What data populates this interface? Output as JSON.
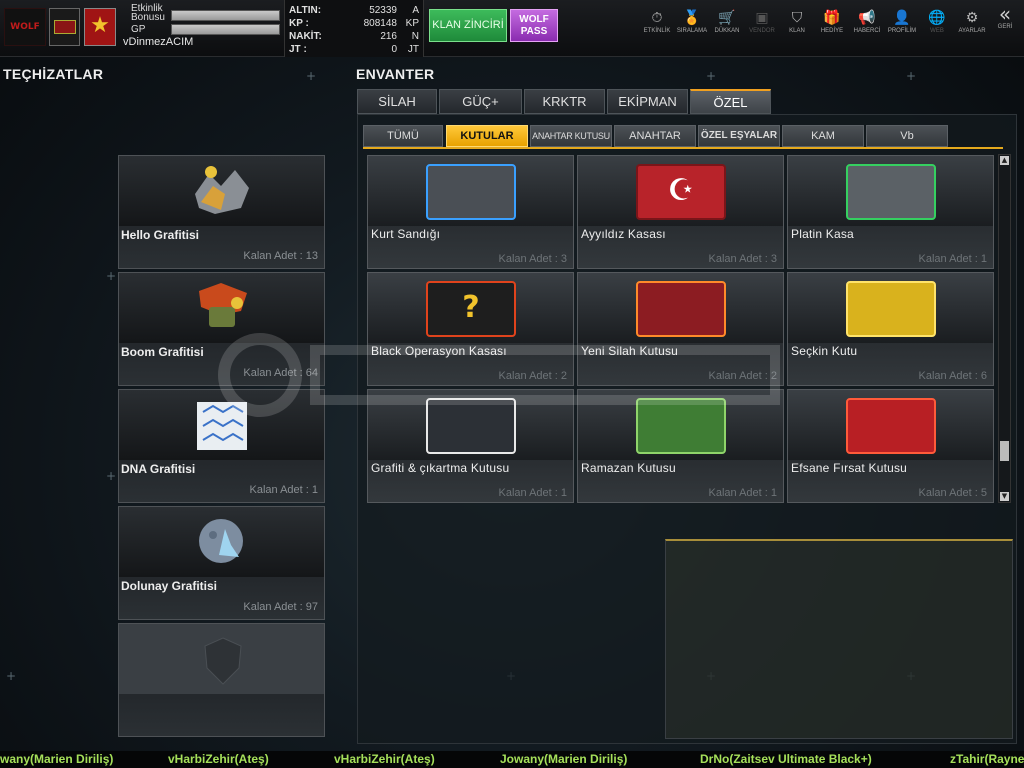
{
  "topbar": {
    "bonus_label_1": "Etkinlik",
    "bonus_label_2": "Bonusu",
    "gp_label": "GP",
    "username": "vDinmezACIM",
    "logo_text": "WOLF",
    "currency": [
      {
        "key": "ALTIN:",
        "value": "52339",
        "unit": "A"
      },
      {
        "key": "KP   :",
        "value": "808148",
        "unit": "KP"
      },
      {
        "key": "NAKİT:",
        "value": "216",
        "unit": "N"
      },
      {
        "key": "JT   :",
        "value": "0",
        "unit": "JT"
      }
    ],
    "klan_button": "KLAN ZİNCİRİ",
    "wolf_pass_1": "WOLF",
    "wolf_pass_2": "PASS",
    "nav": [
      {
        "icon": "stopwatch-icon",
        "glyph": "⏱",
        "label": "ETKİNLİK"
      },
      {
        "icon": "medal-icon",
        "glyph": "🏅",
        "label": "SIRALAMA"
      },
      {
        "icon": "cart-icon",
        "glyph": "🛒",
        "label": "DÜKKAN"
      },
      {
        "icon": "vendor-icon",
        "glyph": "▣",
        "label": "VENDOR"
      },
      {
        "icon": "shield-icon",
        "glyph": "⛉",
        "label": "KLAN"
      },
      {
        "icon": "gift-icon",
        "glyph": "🎁",
        "label": "HEDİYE"
      },
      {
        "icon": "megaphone-icon",
        "glyph": "📢",
        "label": "HABERCİ"
      },
      {
        "icon": "profile-icon",
        "glyph": "👤",
        "label": "PROFİLİM"
      },
      {
        "icon": "globe-icon",
        "glyph": "🌐",
        "label": "WEB"
      },
      {
        "icon": "gear-icon",
        "glyph": "⚙",
        "label": "AYARLAR"
      },
      {
        "icon": "back-icon",
        "glyph": "«",
        "label": "GERİ"
      }
    ]
  },
  "equipment": {
    "title": "TEÇHİZATLAR",
    "items": [
      {
        "name": "Hello Grafitisi",
        "count": "Kalan Adet : 13",
        "art": "#d8a13a"
      },
      {
        "name": "Boom Grafitisi",
        "count": "Kalan Adet : 64",
        "art": "#c94a1c"
      },
      {
        "name": "DNA Grafitisi",
        "count": "Kalan Adet : 1",
        "art": "#3a72c8"
      },
      {
        "name": "Dolunay Grafitisi",
        "count": "Kalan Adet : 97",
        "art": "#7d8da0"
      }
    ]
  },
  "inventory": {
    "title": "ENVANTER",
    "main_tabs": [
      "SİLAH",
      "GÜÇ+",
      "KRKTR",
      "EKİPMAN",
      "ÖZEL"
    ],
    "sub_tabs": [
      "TÜMÜ",
      "KUTULAR",
      "ANAHTAR KUTUSU",
      "ANAHTAR",
      "ÖZEL EŞYALAR",
      "KAM",
      "Vb"
    ],
    "items": [
      {
        "name": "Kurt Sandığı",
        "count": "Kalan Adet : 3",
        "color": "#4a4f55",
        "accent": "#3aa0ff"
      },
      {
        "name": "Ayyıldız Kasası",
        "count": "Kalan Adet : 3",
        "color": "#b8232a",
        "accent": "#ffffff"
      },
      {
        "name": "Platin Kasa",
        "count": "Kalan Adet : 1",
        "color": "#5b6166",
        "accent": "#35d060"
      },
      {
        "name": "Black Operasyon Kasası",
        "count": "Kalan Adet : 2",
        "color": "#1e1e1e",
        "accent": "#e0431c"
      },
      {
        "name": "Yeni Silah Kutusu",
        "count": "Kalan Adet : 2",
        "color": "#8c1c22",
        "accent": "#ff8a2a"
      },
      {
        "name": "Seçkin Kutu",
        "count": "Kalan Adet : 6",
        "color": "#d9b21d",
        "accent": "#ffe36a"
      },
      {
        "name": "Grafiti & çıkartma Kutusu",
        "count": "Kalan Adet : 1",
        "color": "#2c3036",
        "accent": "#e8e8e8"
      },
      {
        "name": "Ramazan Kutusu",
        "count": "Kalan Adet : 1",
        "color": "#3f7d34",
        "accent": "#8fd46a"
      },
      {
        "name": "Efsane Fırsat Kutusu",
        "count": "Kalan Adet : 5",
        "color": "#b81f24",
        "accent": "#ff5a3a"
      }
    ]
  },
  "ticker": [
    "Jowany(Marien Diriliş)",
    "vHarbiZehir(Ateş)",
    "vHarbiZehir(Ateş)",
    "Jowany(Marien Diriliş)",
    "DrNo(Zaitsev Ultimate Black+)",
    "zTahir(Rayne)"
  ],
  "colors": {
    "accent": "#e8a200",
    "ticker": "#a6e05a",
    "highlight": "#f0a020"
  }
}
